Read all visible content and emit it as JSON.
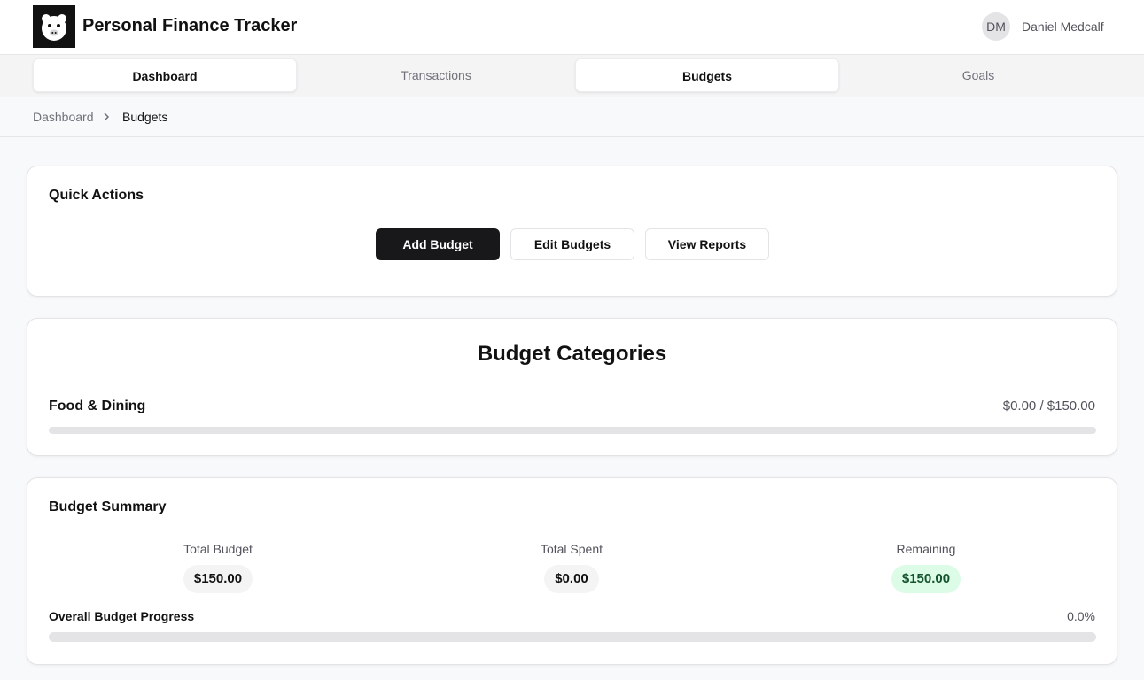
{
  "header": {
    "title": "Personal Finance Tracker",
    "user": {
      "initials": "DM",
      "name": "Daniel Medcalf"
    }
  },
  "tabs": [
    {
      "label": "Dashboard",
      "active": true
    },
    {
      "label": "Transactions",
      "active": false
    },
    {
      "label": "Budgets",
      "active": true
    },
    {
      "label": "Goals",
      "active": false
    }
  ],
  "breadcrumb": {
    "parent": "Dashboard",
    "current": "Budgets"
  },
  "quick_actions": {
    "title": "Quick Actions",
    "add_label": "Add Budget",
    "edit_label": "Edit Budgets",
    "reports_label": "View Reports"
  },
  "categories": {
    "title": "Budget Categories",
    "items": [
      {
        "name": "Food & Dining",
        "amount": "$0.00 / $150.00",
        "progress": 0
      }
    ]
  },
  "summary": {
    "title": "Budget Summary",
    "total_budget": {
      "label": "Total Budget",
      "value": "$150.00"
    },
    "total_spent": {
      "label": "Total Spent",
      "value": "$0.00"
    },
    "remaining": {
      "label": "Remaining",
      "value": "$150.00"
    },
    "overall_label": "Overall Budget Progress",
    "overall_pct": "0.0%",
    "overall_progress": 0
  },
  "colors": {
    "primary": "#18181b",
    "remaining_bg": "#dcfce7",
    "remaining_text": "#14532d",
    "track": "#e4e4e7"
  },
  "icons": {
    "logo": "pig-face-icon",
    "breadcrumb_separator": "chevron-right-icon"
  }
}
